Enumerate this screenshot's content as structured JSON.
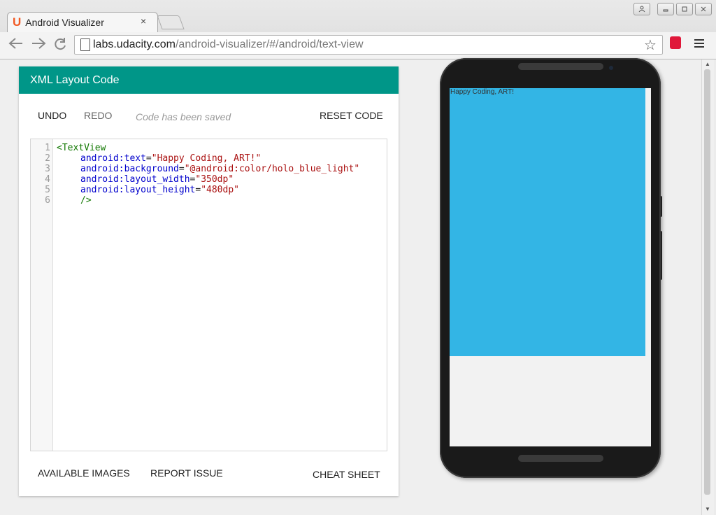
{
  "browser": {
    "tab_title": "Android Visualizer",
    "tab_logo": "U",
    "tab_close": "×",
    "url_domain": "labs.udacity.com",
    "url_path": "/android-visualizer/#/android/text-view",
    "star_icon": "☆"
  },
  "panel": {
    "title": "XML Layout Code",
    "undo": "UNDO",
    "redo": "REDO",
    "saved_status": "Code has been saved",
    "reset": "RESET CODE",
    "available_images": "AVAILABLE IMAGES",
    "report_issue": "REPORT ISSUE",
    "cheat_sheet": "CHEAT SHEET"
  },
  "code": {
    "line_numbers": [
      "1",
      "2",
      "3",
      "4",
      "5",
      "6"
    ],
    "open_tag": "<TextView",
    "lines": [
      {
        "attr": "android:text",
        "eq": "=",
        "val": "\"Happy Coding, ART!\""
      },
      {
        "attr": "android:background",
        "eq": "=",
        "val": "\"@android:color/holo_blue_light\""
      },
      {
        "attr": "android:layout_width",
        "eq": "=",
        "val": "\"350dp\""
      },
      {
        "attr": "android:layout_height",
        "eq": "=",
        "val": "\"480dp\""
      }
    ],
    "close_tag": "/>"
  },
  "preview": {
    "text": "Happy Coding, ART!",
    "background": "#33b5e5"
  },
  "colors": {
    "header": "#009688",
    "accent": "#f15a24"
  }
}
